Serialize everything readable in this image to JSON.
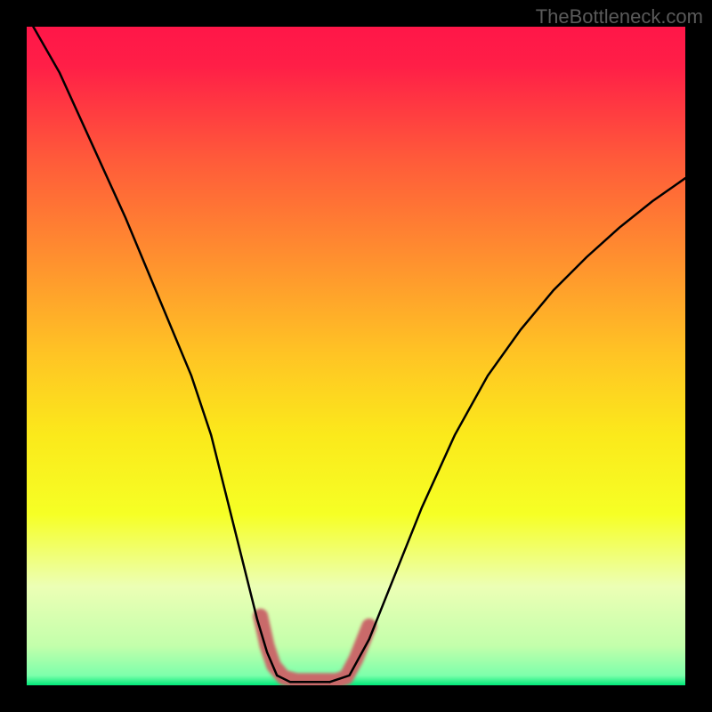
{
  "watermark": "TheBottleneck.com",
  "chart_data": {
    "type": "line",
    "title": "",
    "xlabel": "",
    "ylabel": "",
    "xlim": [
      0,
      100
    ],
    "ylim": [
      0,
      100
    ],
    "left_branch": {
      "description": "descending curve from top-left to trough",
      "points_xy": [
        [
          1,
          100
        ],
        [
          5,
          93
        ],
        [
          10,
          82
        ],
        [
          15,
          71
        ],
        [
          20,
          59
        ],
        [
          25,
          47
        ],
        [
          28,
          38
        ],
        [
          30,
          30
        ],
        [
          32,
          22
        ],
        [
          34,
          14
        ],
        [
          35,
          10
        ],
        [
          36.5,
          5
        ],
        [
          38,
          1.5
        ],
        [
          40,
          0.5
        ],
        [
          43,
          0.5
        ],
        [
          46,
          0.5
        ]
      ]
    },
    "right_branch": {
      "description": "ascending curve from trough to right edge",
      "points_xy": [
        [
          46,
          0.5
        ],
        [
          49,
          1.5
        ],
        [
          52,
          7
        ],
        [
          56,
          17
        ],
        [
          60,
          27
        ],
        [
          65,
          38
        ],
        [
          70,
          47
        ],
        [
          75,
          54
        ],
        [
          80,
          60
        ],
        [
          85,
          65
        ],
        [
          90,
          69.5
        ],
        [
          95,
          73.5
        ],
        [
          100,
          77
        ]
      ]
    },
    "trough_highlight": {
      "description": "thick blurred pink/coral segment near minimum",
      "points_xy": [
        [
          35.5,
          10.5
        ],
        [
          36.5,
          6
        ],
        [
          37.5,
          3
        ],
        [
          39,
          1.2
        ],
        [
          41,
          0.7
        ],
        [
          43,
          0.7
        ],
        [
          45,
          0.7
        ],
        [
          47,
          0.7
        ],
        [
          48.5,
          1.2
        ],
        [
          50,
          4
        ],
        [
          51,
          6.5
        ],
        [
          52,
          9
        ]
      ]
    },
    "gradient_stops": [
      {
        "offset": 0.0,
        "color": "#ff1648"
      },
      {
        "offset": 0.06,
        "color": "#ff1f47"
      },
      {
        "offset": 0.2,
        "color": "#ff5a3a"
      },
      {
        "offset": 0.35,
        "color": "#ff8f2f"
      },
      {
        "offset": 0.5,
        "color": "#ffc524"
      },
      {
        "offset": 0.62,
        "color": "#fbe91b"
      },
      {
        "offset": 0.74,
        "color": "#f6ff25"
      },
      {
        "offset": 0.85,
        "color": "#ecffb5"
      },
      {
        "offset": 0.94,
        "color": "#c3ffab"
      },
      {
        "offset": 0.985,
        "color": "#7dffab"
      },
      {
        "offset": 1.0,
        "color": "#00e879"
      }
    ],
    "highlight_color": "#c96a6a",
    "curve_color": "#000000"
  }
}
